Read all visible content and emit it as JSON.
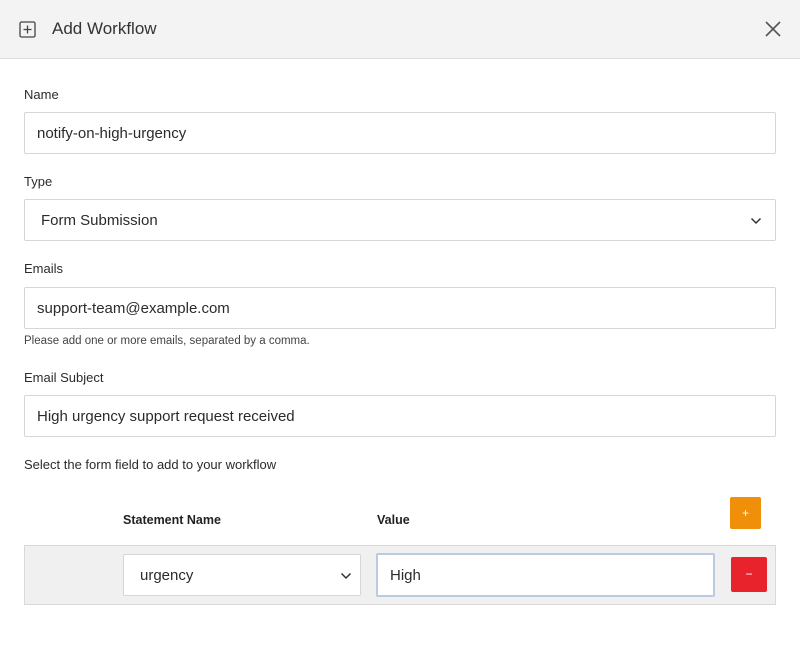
{
  "dialog": {
    "title": "Add Workflow"
  },
  "form": {
    "name": {
      "label": "Name",
      "value": "notify-on-high-urgency"
    },
    "type": {
      "label": "Type",
      "selected": "Form Submission"
    },
    "emails": {
      "label": "Emails",
      "value": "support-team@example.com",
      "help": "Please add one or more emails, separated by a comma."
    },
    "subject": {
      "label": "Email Subject",
      "value": "High urgency support request received"
    },
    "fields_prompt": "Select the form field to add to your workflow"
  },
  "conditions": {
    "headers": {
      "statement": "Statement Name",
      "value": "Value"
    },
    "add_label": "+",
    "rows": [
      {
        "statement": "urgency",
        "value": "High",
        "remove_label": "−"
      }
    ]
  },
  "colors": {
    "add_button": "#f0900a",
    "remove_button": "#e8232c",
    "header_bg": "#f3f3f3",
    "focus_border": "#b9cbe3"
  }
}
